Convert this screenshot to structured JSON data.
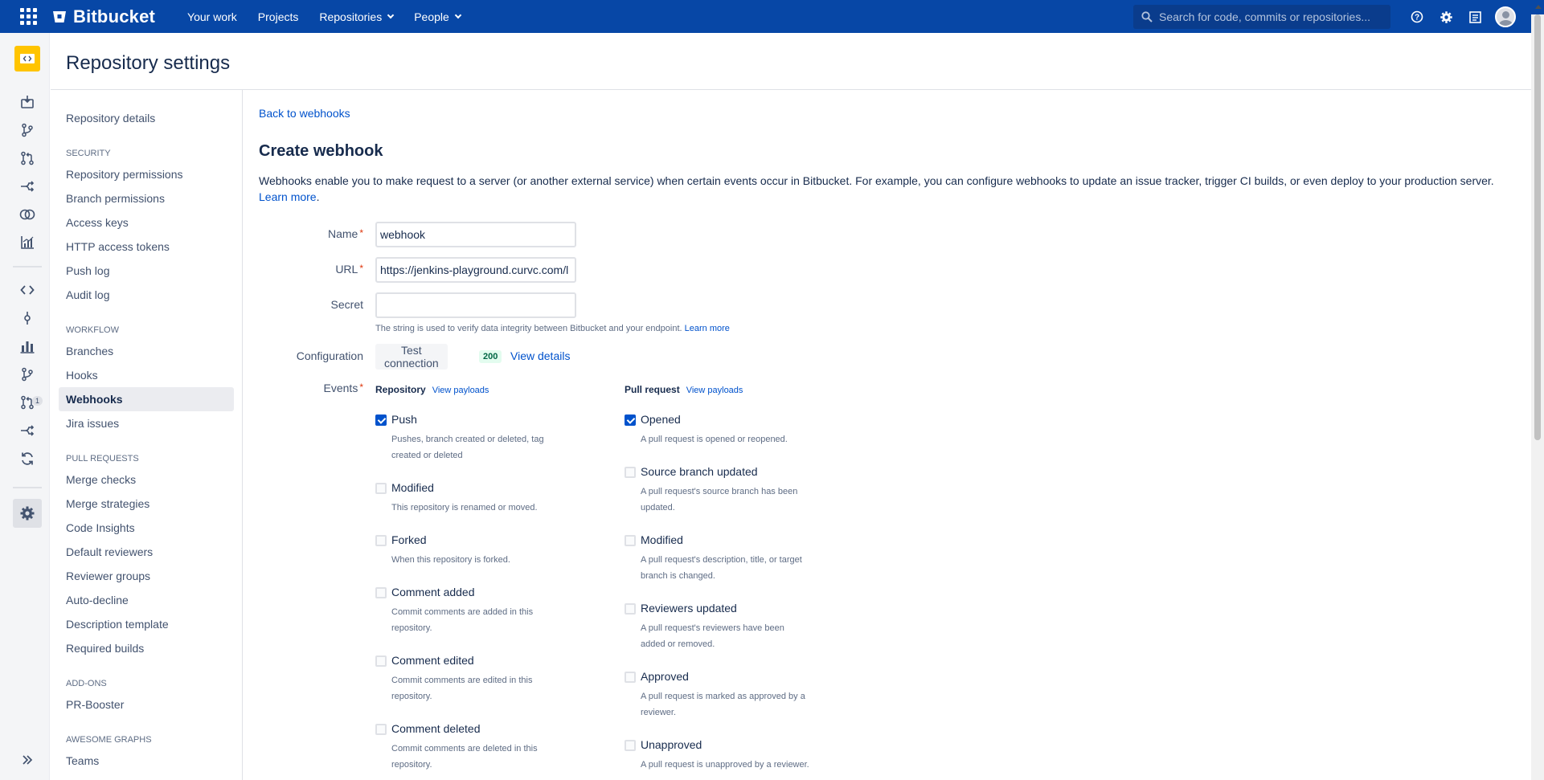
{
  "topbar": {
    "brand": "Bitbucket",
    "nav": [
      {
        "label": "Your work",
        "dropdown": false
      },
      {
        "label": "Projects",
        "dropdown": false
      },
      {
        "label": "Repositories",
        "dropdown": true
      },
      {
        "label": "People",
        "dropdown": true
      }
    ],
    "search_placeholder": "Search for code, commits or repositories...",
    "icons": [
      "help-icon",
      "settings-icon",
      "inbox-icon",
      "user-avatar"
    ]
  },
  "leftrail": {
    "badge": "1",
    "icons": [
      "repository-avatar-icon",
      "clone-icon",
      "create-branch-icon",
      "create-pull-request-icon",
      "fork-icon",
      "compare-icon",
      "insights-icon",
      "source-icon",
      "commits-icon",
      "reports-icon",
      "branches-icon",
      "pull-requests-icon",
      "forks-icon",
      "builds-icon",
      "repository-settings-icon",
      "expand-sidebar-icon"
    ]
  },
  "page": {
    "title": "Repository settings"
  },
  "settings_nav": {
    "items_top": [
      "Repository details"
    ],
    "sections": [
      {
        "title": "SECURITY",
        "items": [
          "Repository permissions",
          "Branch permissions",
          "Access keys",
          "HTTP access tokens",
          "Push log",
          "Audit log"
        ]
      },
      {
        "title": "WORKFLOW",
        "items": [
          "Branches",
          "Hooks",
          "Webhooks",
          "Jira issues"
        ]
      },
      {
        "title": "PULL REQUESTS",
        "items": [
          "Merge checks",
          "Merge strategies",
          "Code Insights",
          "Default reviewers",
          "Reviewer groups",
          "Auto-decline",
          "Description template",
          "Required builds"
        ]
      },
      {
        "title": "ADD-ONS",
        "items": [
          "PR-Booster"
        ]
      },
      {
        "title": "AWESOME GRAPHS",
        "items": [
          "Teams"
        ]
      }
    ],
    "active": "Webhooks"
  },
  "webhook": {
    "back_link": "Back to webhooks",
    "title": "Create webhook",
    "description": "Webhooks enable you to make request to a server (or another external service) when certain events occur in Bitbucket. For example, you can configure webhooks to update an issue tracker, trigger CI builds, or even deploy to your production server.",
    "learn_more": "Learn more",
    "name_label": "Name",
    "name_value": "webhook",
    "url_label": "URL",
    "url_value": "https://jenkins-playground.curvc.com/l",
    "secret_label": "Secret",
    "secret_value": "",
    "secret_hint": "The string is used to verify data integrity between Bitbucket and your endpoint.",
    "secret_hint_link": "Learn more",
    "config_label": "Configuration",
    "test_button": "Test connection",
    "status_code": "200",
    "view_details": "View details",
    "events_label": "Events",
    "repository_header": "Repository",
    "pull_request_header": "Pull request",
    "view_payloads": "View payloads",
    "repository_events": [
      {
        "name": "Push",
        "desc": "Pushes, branch created or deleted, tag created or deleted",
        "checked": true
      },
      {
        "name": "Modified",
        "desc": "This repository is renamed or moved.",
        "checked": false
      },
      {
        "name": "Forked",
        "desc": "When this repository is forked.",
        "checked": false
      },
      {
        "name": "Comment added",
        "desc": "Commit comments are added in this repository.",
        "checked": false
      },
      {
        "name": "Comment edited",
        "desc": "Commit comments are edited in this repository.",
        "checked": false
      },
      {
        "name": "Comment deleted",
        "desc": "Commit comments are deleted in this repository.",
        "checked": false
      }
    ],
    "pull_request_events": [
      {
        "name": "Opened",
        "desc": "A pull request is opened or reopened.",
        "checked": true
      },
      {
        "name": "Source branch updated",
        "desc": "A pull request's source branch has been updated.",
        "checked": false
      },
      {
        "name": "Modified",
        "desc": "A pull request's description, title, or target branch is changed.",
        "checked": false
      },
      {
        "name": "Reviewers updated",
        "desc": "A pull request's reviewers have been added or removed.",
        "checked": false
      },
      {
        "name": "Approved",
        "desc": "A pull request is marked as approved by a reviewer.",
        "checked": false
      },
      {
        "name": "Unapproved",
        "desc": "A pull request is unapproved by a reviewer.",
        "checked": false
      }
    ]
  },
  "colors": {
    "topbar": "#0747a6",
    "link": "#0052cc",
    "repo_avatar": "#ffc400",
    "checkbox_checked": "#0052cc"
  }
}
